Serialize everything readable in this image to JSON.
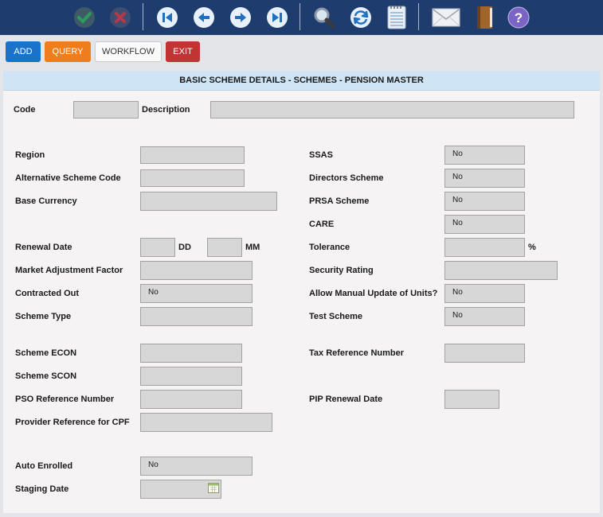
{
  "toolbar": {
    "icons": [
      "checkmark-icon",
      "cancel-icon",
      "first-record-icon",
      "previous-record-icon",
      "next-record-icon",
      "last-record-icon",
      "search-icon",
      "refresh-icon",
      "notepad-icon",
      "mail-icon",
      "book-icon",
      "help-icon"
    ],
    "help_glyph": "?"
  },
  "actions": {
    "add": "ADD",
    "query": "QUERY",
    "workflow": "WORKFLOW",
    "exit": "EXIT"
  },
  "colors": {
    "toolbar": "#1f3c6e",
    "add": "#1a73c8",
    "query": "#f07d1c",
    "exit": "#c13434",
    "title_bar": "#cfe4f4"
  },
  "panel_title": "BASIC SCHEME DETAILS - SCHEMES - PENSION MASTER",
  "form": {
    "code_label": "Code",
    "description_label": "Description",
    "region_label": "Region",
    "alt_scheme_code_label": "Alternative Scheme Code",
    "base_currency_label": "Base Currency",
    "renewal_date_label": "Renewal Date",
    "dd_label": "DD",
    "mm_label": "MM",
    "market_adj_label": "Market Adjustment Factor",
    "contracted_out_label": "Contracted Out",
    "contracted_out_value": "No",
    "scheme_type_label": "Scheme Type",
    "scheme_econ_label": "Scheme ECON",
    "scheme_scon_label": "Scheme SCON",
    "pso_ref_label": "PSO Reference Number",
    "provider_ref_label": "Provider Reference for CPF",
    "auto_enrolled_label": "Auto Enrolled",
    "auto_enrolled_value": "No",
    "staging_date_label": "Staging Date",
    "ssas_label": "SSAS",
    "ssas_value": "No",
    "directors_label": "Directors Scheme",
    "directors_value": "No",
    "prsa_label": "PRSA Scheme",
    "prsa_value": "No",
    "care_label": "CARE",
    "care_value": "No",
    "tolerance_label": "Tolerance",
    "percent_label": "%",
    "security_label": "Security Rating",
    "allow_manual_label": "Allow Manual Update of Units?",
    "allow_manual_value": "No",
    "test_scheme_label": "Test Scheme",
    "test_scheme_value": "No",
    "tax_ref_label": "Tax Reference Number",
    "pip_renewal_label": "PIP Renewal Date"
  }
}
